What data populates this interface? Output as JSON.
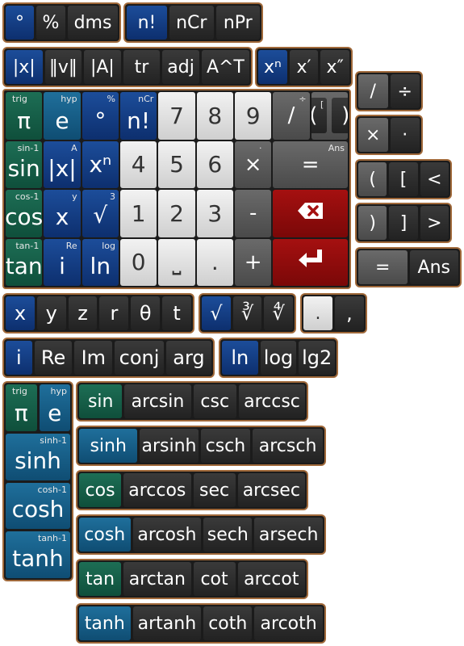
{
  "row1": {
    "groupA": [
      "°",
      "%",
      "dms"
    ],
    "groupB": [
      "n!",
      "nCr",
      "nPr"
    ]
  },
  "row2": {
    "groupA": [
      "|x|",
      "‖v‖",
      "|A|",
      "tr",
      "adj",
      "A^T"
    ],
    "groupB": [
      "xⁿ",
      "x′",
      "x″"
    ]
  },
  "right_panels": {
    "div": [
      "/",
      "÷"
    ],
    "mul": [
      "×",
      "·"
    ],
    "open": [
      "(",
      "[",
      "<"
    ],
    "close": [
      ")",
      "]",
      ">"
    ],
    "eq": [
      "=",
      "Ans"
    ]
  },
  "keypad": {
    "col1": [
      {
        "main": "π",
        "sub": "trig"
      },
      {
        "main": "sin",
        "sup": "sin-1"
      },
      {
        "main": "cos",
        "sup": "cos-1"
      },
      {
        "main": "tan",
        "sup": "tan-1"
      }
    ],
    "col2": [
      {
        "main": "e",
        "sup": "hyp"
      },
      {
        "main": "|x|",
        "sup": "A"
      },
      {
        "main": "x",
        "sup": "y"
      },
      {
        "main": "i",
        "sup": "Re"
      }
    ],
    "col3": [
      {
        "main": "°",
        "sup": "%"
      },
      {
        "main": "n!",
        "sup": "nCr"
      },
      {
        "main": "√",
        "sup": "3"
      },
      {
        "main": "ln",
        "sup": "log"
      }
    ],
    "col3b": [
      {
        "main": "xⁿ",
        "sup": ""
      }
    ],
    "digits": [
      "7",
      "8",
      "9",
      "4",
      "5",
      "6",
      "1",
      "2",
      "3",
      "0",
      "⎵",
      "."
    ],
    "ops": [
      {
        "main": "/",
        "sup": "÷"
      },
      {
        "main": "×",
        "sup": "·"
      },
      {
        "main": "-",
        "sup": ""
      },
      {
        "main": "+",
        "sup": ""
      }
    ],
    "brackets": [
      {
        "main": "(",
        "sup": "["
      },
      {
        "main": ")",
        "sup": "]"
      }
    ],
    "equals": {
      "main": "=",
      "sup": "Ans"
    },
    "backspace_icon": "backspace-icon",
    "enter_icon": "enter-icon"
  },
  "row_vars": {
    "vars": [
      "x",
      "y",
      "z",
      "r",
      "θ",
      "t"
    ],
    "roots": [
      "√",
      "∛",
      "∜"
    ],
    "punct": [
      ".",
      ","
    ]
  },
  "row_complex": {
    "complex": [
      "i",
      "Re",
      "Im",
      "conj",
      "arg"
    ],
    "logs": [
      "ln",
      "log",
      "lg2"
    ]
  },
  "left_trig_panel": [
    {
      "main": "π",
      "sup": "trig",
      "main2": "e",
      "sup2": "hyp"
    },
    {
      "main": "sinh",
      "sup": "sinh-1"
    },
    {
      "main": "cosh",
      "sup": "cosh-1"
    },
    {
      "main": "tanh",
      "sup": "tanh-1"
    }
  ],
  "trig_rows": [
    [
      "sin",
      "arcsin",
      "csc",
      "arccsc"
    ],
    [
      "sinh",
      "arsinh",
      "csch",
      "arcsch"
    ],
    [
      "cos",
      "arccos",
      "sec",
      "arcsec"
    ],
    [
      "cosh",
      "arcosh",
      "sech",
      "arsech"
    ],
    [
      "tan",
      "arctan",
      "cot",
      "arccot"
    ],
    [
      "tanh",
      "artanh",
      "coth",
      "arcoth"
    ]
  ],
  "colors": {
    "border": "#a0693a",
    "blue": "#1c4d9a",
    "green": "#1d6e55",
    "teal": "#1f6f9b",
    "red": "#a51010"
  }
}
